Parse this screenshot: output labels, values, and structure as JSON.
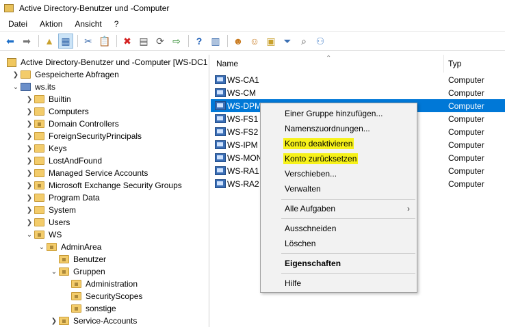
{
  "window": {
    "title": "Active Directory-Benutzer und -Computer"
  },
  "menu": [
    "Datei",
    "Aktion",
    "Ansicht",
    "?"
  ],
  "tree": {
    "root": "Active Directory-Benutzer und -Computer [WS-DC1",
    "saved_queries": "Gespeicherte Abfragen",
    "domain": "ws.its",
    "items": [
      {
        "label": "Builtin"
      },
      {
        "label": "Computers"
      },
      {
        "label": "Domain Controllers"
      },
      {
        "label": "ForeignSecurityPrincipals"
      },
      {
        "label": "Keys"
      },
      {
        "label": "LostAndFound"
      },
      {
        "label": "Managed Service Accounts"
      },
      {
        "label": "Microsoft Exchange Security Groups"
      },
      {
        "label": "Program Data"
      },
      {
        "label": "System"
      },
      {
        "label": "Users"
      },
      {
        "label": "WS"
      }
    ],
    "ws_children": {
      "adminarea": "AdminArea",
      "benutzer": "Benutzer",
      "gruppen": "Gruppen",
      "administration": "Administration",
      "securityscopes": "SecurityScopes",
      "sonstige": "sonstige",
      "service_accounts": "Service-Accounts"
    }
  },
  "list": {
    "columns": {
      "name": "Name",
      "type": "Typ"
    },
    "rows": [
      {
        "name": "WS-CA1",
        "type": "Computer"
      },
      {
        "name": "WS-CM",
        "type": "Computer"
      },
      {
        "name": "WS-DPM",
        "type": "Computer"
      },
      {
        "name": "WS-FS1",
        "type": "Computer"
      },
      {
        "name": "WS-FS2",
        "type": "Computer"
      },
      {
        "name": "WS-IPM",
        "type": "Computer"
      },
      {
        "name": "WS-MON",
        "type": "Computer"
      },
      {
        "name": "WS-RA1",
        "type": "Computer"
      },
      {
        "name": "WS-RA2",
        "type": "Computer"
      }
    ],
    "selected_index": 2
  },
  "context_menu": {
    "add_to_group": "Einer Gruppe hinzufügen...",
    "name_mappings": "Namenszuordnungen...",
    "disable_account": "Konto deaktivieren",
    "reset_account": "Konto zurücksetzen",
    "move": "Verschieben...",
    "manage": "Verwalten",
    "all_tasks": "Alle Aufgaben",
    "cut": "Ausschneiden",
    "delete": "Löschen",
    "properties": "Eigenschaften",
    "help": "Hilfe",
    "highlight_color": "#f7f21a"
  },
  "colors": {
    "selection": "#0078d7",
    "folder": "#f3cc6b"
  }
}
